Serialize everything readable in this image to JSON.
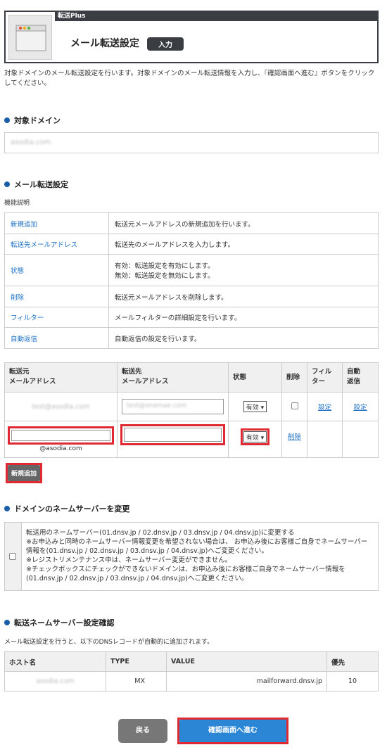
{
  "header": {
    "brand": "転送Plus",
    "title": "メール転送設定",
    "badge": "入力"
  },
  "intro": "対象ドメインのメール転送設定を行います。対象ドメインのメール転送情報を入力し、『確認画面へ進む』ボタンをクリックしてください。",
  "domain_section": {
    "title": "対象ドメイン",
    "value": "asodia.com"
  },
  "forward_section": {
    "title": "メール転送設定",
    "func_label": "機能説明",
    "functions": [
      {
        "key": "新規追加",
        "desc": "転送元メールアドレスの新規追加を行います。"
      },
      {
        "key": "転送先メールアドレス",
        "desc": "転送先のメールアドレスを入力します。"
      },
      {
        "key": "状態",
        "desc": "有効：転送設定を有効にします。",
        "desc2": "無効：転送設定を無効にします。"
      },
      {
        "key": "削除",
        "desc": "転送元メールアドレスを削除します。"
      },
      {
        "key": "フィルター",
        "desc": "メールフィルターの詳細設定を行います。"
      },
      {
        "key": "自動返信",
        "desc": "自動返信の設定を行います。"
      }
    ],
    "table_headers": {
      "from_1": "転送元",
      "from_2": "メールアドレス",
      "to_1": "転送先",
      "to_2": "メールアドレス",
      "status": "状態",
      "delete": "削除",
      "filter_1": "フィル",
      "filter_2": "ター",
      "auto_1": "自動",
      "auto_2": "返信"
    },
    "row1": {
      "from": "test@asodia.com",
      "to": "test@onamae.com",
      "status": "有効",
      "filter": "設定",
      "auto": "設定"
    },
    "row2": {
      "from_domain": "@asodia.com",
      "status": "有効",
      "delete": "削除"
    },
    "add_button": "新規追加"
  },
  "nameserver_section": {
    "title": "ドメインのネームサーバーを変更",
    "line1": "転送用のネームサーバー(01.dnsv.jp / 02.dnsv.jp / 03.dnsv.jp / 04.dnsv.jp)に変更する",
    "line2": "※お申込みと同時のネームサーバー情報変更を希望されない場合は、 お申込み後にお客様ご自身でネームサーバー情報を(01.dnsv.jp / 02.dnsv.jp / 03.dnsv.jp / 04.dnsv.jp)へご変更ください。",
    "line3": "※レジストリメンテナンス中は、ネームサーバー変更ができません。",
    "line4": "※チェックボックスにチェックができないドメインは、お申込み後にお客様ご自身でネームサーバー情報を(01.dnsv.jp / 02.dnsv.jp / 03.dnsv.jp / 04.dnsv.jp)へご変更ください。"
  },
  "dns_section": {
    "title": "転送ネームサーバー設定確認",
    "desc": "メール転送設定を行うと、以下のDNSレコードが自動的に追加されます。",
    "headers": {
      "host": "ホスト名",
      "type": "TYPE",
      "value": "VALUE",
      "priority": "優先"
    },
    "row": {
      "host": "asodia.com",
      "type": "MX",
      "value": "mailforward.dnsv.jp",
      "priority": "10"
    }
  },
  "buttons": {
    "back": "戻る",
    "confirm": "確認画面へ進む"
  }
}
